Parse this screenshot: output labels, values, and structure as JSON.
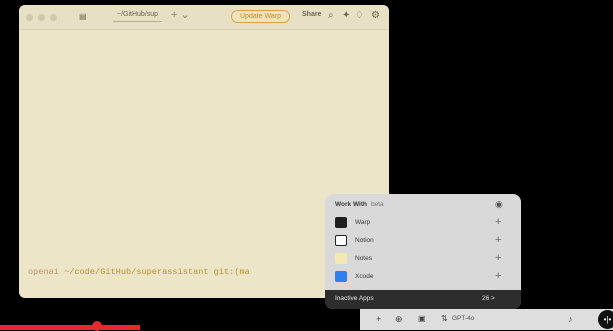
{
  "terminal": {
    "tab_label": "~/GitHub/sup",
    "tab_add_label": "+ ⌄",
    "update_button": "Update Warp",
    "share_label": "Share",
    "prompt_user": "openai",
    "prompt_path": " ~/code/GitHub/superassistant git:(ma"
  },
  "panel": {
    "title": "Work With",
    "subtitle": "beta",
    "apps": [
      {
        "name": "Warp",
        "icon": "warp-icon"
      },
      {
        "name": "Notion",
        "icon": "notion-icon"
      },
      {
        "name": "Notes",
        "icon": "notes-icon"
      },
      {
        "name": "Xcode",
        "icon": "xcode-icon"
      }
    ],
    "plus": "+",
    "inactive_label": "Inactive Apps",
    "inactive_count": "26 >"
  },
  "chatbar": {
    "add": "+",
    "model": "GPT-4o",
    "voice": "•|•"
  }
}
